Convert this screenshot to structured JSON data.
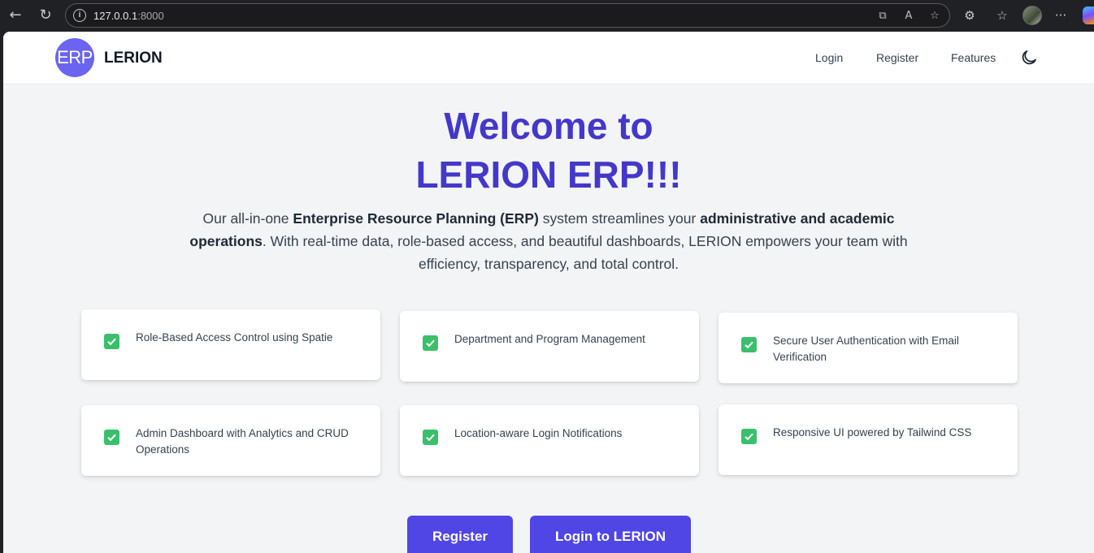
{
  "browser": {
    "url_host": "127.0.0.1",
    "url_port": ":8000"
  },
  "header": {
    "logo_text": "ERP",
    "brand": "LERION",
    "nav": [
      "Login",
      "Register",
      "Features"
    ]
  },
  "hero": {
    "title_line1": "Welcome to",
    "title_line2": "LERION ERP!!!",
    "lead": {
      "p1": "Our all-in-one ",
      "b1": "Enterprise Resource Planning (ERP)",
      "p2": " system streamlines your ",
      "b2": "administrative and academic operations",
      "p3": ". With real-time data, role-based access, and beautiful dashboards, LERION empowers your team with efficiency, transparency, and total control."
    }
  },
  "features": [
    "Role-Based Access Control using Spatie",
    "Department and Program Management",
    "Secure User Authentication with Email Verification",
    "Admin Dashboard with Analytics and CRUD Operations",
    "Location-aware Login Notifications",
    "Responsive UI powered by Tailwind CSS"
  ],
  "actions": {
    "register": "Register",
    "login": "Login to LERION"
  },
  "colors": {
    "primary": "#4f46e5",
    "title": "#4338ca",
    "check": "#3bbf6c"
  }
}
